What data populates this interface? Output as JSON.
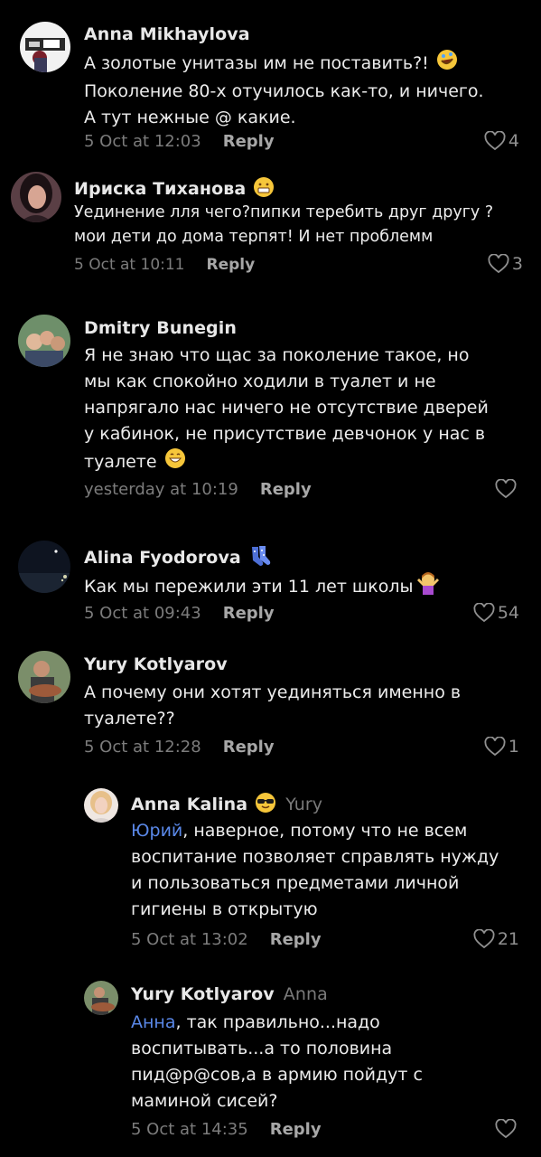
{
  "colors": {
    "background": "#000000",
    "text": "#ececec",
    "meta": "#7c7c7c",
    "reply": "#a7a7a7",
    "mention": "#5a88e8"
  },
  "comments": [
    {
      "author": "Anna Mikhaylova",
      "lines": [
        "А золотые унитазы им не поставить?!",
        "Поколение 80-х отучилось как-то, и ничего.",
        "А тут нежные @ какие."
      ],
      "emoji": "rofl-emoji",
      "time": "5 Oct at 12:03",
      "reply_label": "Reply",
      "likes": "4"
    },
    {
      "author": "Ириска Тиханова",
      "author_emoji": "grimace-emoji",
      "lines": [
        "Уединение лля чего?пипки теребить друг другу ?",
        "мои дети до дома терпят! И нет проблемм"
      ],
      "time": "5 Oct at 10:11",
      "reply_label": "Reply",
      "likes": "3"
    },
    {
      "author": "Dmitry Bunegin",
      "lines": [
        "Я не знаю что щас за поколение такое, но",
        "мы как спокойно ходили в туалет и не",
        "напрягало нас ничего не отсутствие дверей",
        "у кабинок, не присутствие девчонок у нас в",
        "туалете"
      ],
      "emoji": "grin-emoji",
      "time": "yesterday at 10:19",
      "reply_label": "Reply",
      "likes": ""
    },
    {
      "author": "Alina Fyodorova",
      "author_emoji": "socks-emoji",
      "lines": [
        "Как мы пережили эти 11 лет школы"
      ],
      "emoji": "shrug-emoji",
      "time": "5 Oct at 09:43",
      "reply_label": "Reply",
      "likes": "54"
    },
    {
      "author": "Yury Kotlyarov",
      "lines": [
        "А почему они хотят уединяться именно в",
        "туалете??"
      ],
      "time": "5 Oct at 12:28",
      "reply_label": "Reply",
      "likes": "1"
    },
    {
      "author": "Anna Kalina",
      "author_emoji": "sunglasses-emoji",
      "reply_to": "Yury",
      "mention": "Юрий",
      "lines": [
        ", наверное, потому что не всем",
        "воспитание позволяет справлять нужду",
        "и пользоваться предметами личной",
        "гигиены в открытую"
      ],
      "time": "5 Oct at 13:02",
      "reply_label": "Reply",
      "likes": "21"
    },
    {
      "author": "Yury Kotlyarov",
      "reply_to": "Anna",
      "mention": "Анна",
      "lines": [
        ", так правильно...надо",
        "воспитывать...а то половина",
        "пид@р@сов,а в армию пойдут с",
        "маминой сисей?"
      ],
      "time": "5 Oct at 14:35",
      "reply_label": "Reply",
      "likes": ""
    }
  ]
}
